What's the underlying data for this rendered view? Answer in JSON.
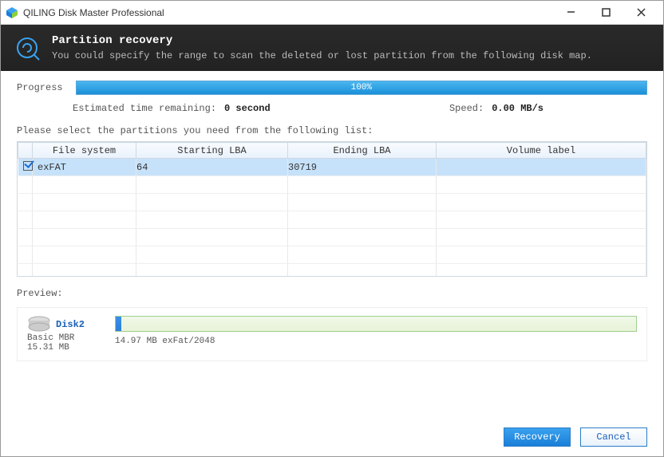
{
  "window": {
    "title": "QILING Disk Master Professional"
  },
  "banner": {
    "title": "Partition recovery",
    "sub": "You could specify the range to scan the deleted or lost partition from the following disk map."
  },
  "progress": {
    "label": "Progress",
    "percent_text": "100%",
    "eta_label": "Estimated time remaining:",
    "eta_value": "0 second",
    "speed_label": "Speed:",
    "speed_value": "0.00 MB/s"
  },
  "instruction": "Please select the partitions you need from the following list:",
  "table": {
    "headers": {
      "fs": "File system",
      "slba": "Starting LBA",
      "elba": "Ending LBA",
      "vlabel": "Volume label"
    },
    "row": {
      "checked": true,
      "fs": "exFAT",
      "slba": "64",
      "elba": "30719",
      "vlabel": ""
    }
  },
  "preview": {
    "label": "Preview:",
    "disk_name": "Disk2",
    "disk_type": "Basic MBR",
    "disk_size": "15.31 MB",
    "part_caption": "14.97 MB exFat/2048"
  },
  "footer": {
    "recovery": "Recovery",
    "cancel": "Cancel"
  }
}
